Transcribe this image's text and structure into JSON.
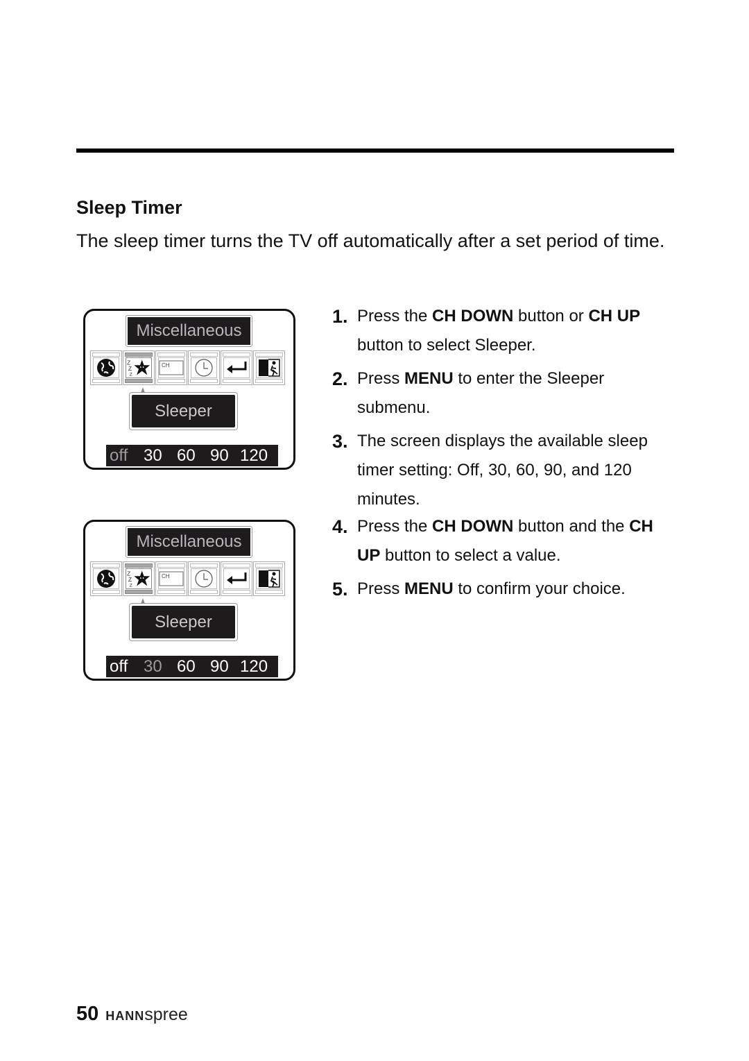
{
  "section": {
    "title": "Sleep Timer",
    "intro": "The sleep timer turns the TV off automatically after a set period of time."
  },
  "osd_screens": [
    {
      "menu_title": "Miscellaneous",
      "icons": [
        "globe-icon",
        "sleep-star-icon",
        "channel-icon",
        "clock-icon",
        "return-icon",
        "exit-icon"
      ],
      "selected_icon": "sleep-star-icon",
      "submenu_label": "Sleeper",
      "values": [
        "off",
        "30",
        "60",
        "90",
        "120"
      ],
      "highlighted_value": "off"
    },
    {
      "menu_title": "Miscellaneous",
      "icons": [
        "globe-icon",
        "sleep-star-icon",
        "channel-icon",
        "clock-icon",
        "return-icon",
        "exit-icon"
      ],
      "selected_icon": "sleep-star-icon",
      "submenu_label": "Sleeper",
      "values": [
        "off",
        "30",
        "60",
        "90",
        "120"
      ],
      "highlighted_value": "30"
    }
  ],
  "channel_icon_text": "CH",
  "steps": [
    {
      "num": "1.",
      "parts": [
        "Press the ",
        "CH DOWN",
        " button or ",
        "CH UP",
        " button to select Sleeper."
      ]
    },
    {
      "num": "2.",
      "parts": [
        "Press ",
        "MENU",
        " to enter the Sleeper submenu."
      ]
    },
    {
      "num": "3.",
      "parts": [
        "The screen displays the available sleep timer setting: Off, 30, 60, 90, and 120 minutes."
      ]
    },
    {
      "num": "4.",
      "parts": [
        "Press the ",
        "CH DOWN",
        " button and the ",
        "CH UP",
        " button to select a value."
      ]
    },
    {
      "num": "5.",
      "parts": [
        "Press ",
        "MENU",
        " to confirm your choice."
      ]
    }
  ],
  "footer": {
    "page_number": "50",
    "brand_bold": "HANN",
    "brand_light": "spree"
  }
}
